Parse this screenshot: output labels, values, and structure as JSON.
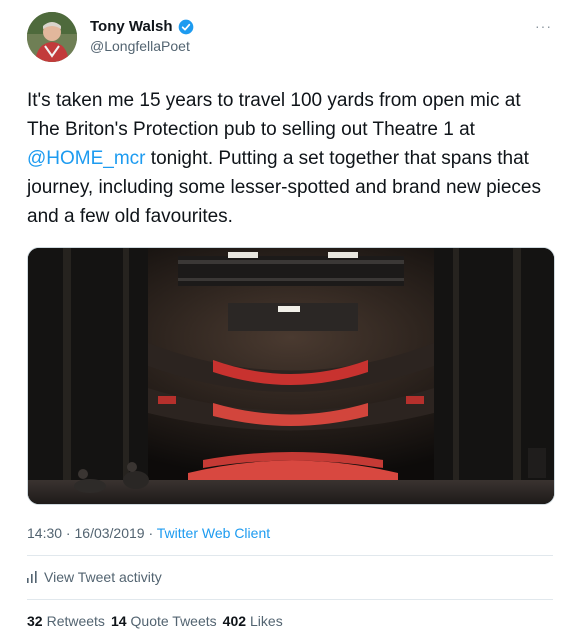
{
  "author": {
    "display_name": "Tony Walsh",
    "handle": "@LongfellaPoet",
    "verified": true,
    "avatar_icon": "avatar-photo"
  },
  "menu": {
    "more_label": "···"
  },
  "tweet": {
    "text_part1": "It's taken me 15 years to travel 100 yards from open mic at The Briton's Protection pub to selling out Theatre 1 at ",
    "mention": "@HOME_mcr",
    "text_part2": " tonight. Putting a set together that spans that journey, including some lesser-spotted and brand new pieces and a few old favourites."
  },
  "media": {
    "kind": "photo",
    "subject": "theatre-auditorium-photo"
  },
  "meta": {
    "time": "14:30",
    "separator1": " · ",
    "date": "16/03/2019",
    "separator2": " · ",
    "client": "Twitter Web Client"
  },
  "activity": {
    "label": "View Tweet activity",
    "icon": "bar-chart-icon"
  },
  "stats": {
    "retweets_count": "32",
    "retweets_label": "Retweets",
    "quotes_count": "14",
    "quotes_label": "Quote Tweets",
    "likes_count": "402",
    "likes_label": "Likes"
  },
  "colors": {
    "link": "#1d9bf0",
    "secondary_text": "#536471",
    "primary_text": "#0f1419",
    "verified_badge": "#1d9bf0"
  }
}
